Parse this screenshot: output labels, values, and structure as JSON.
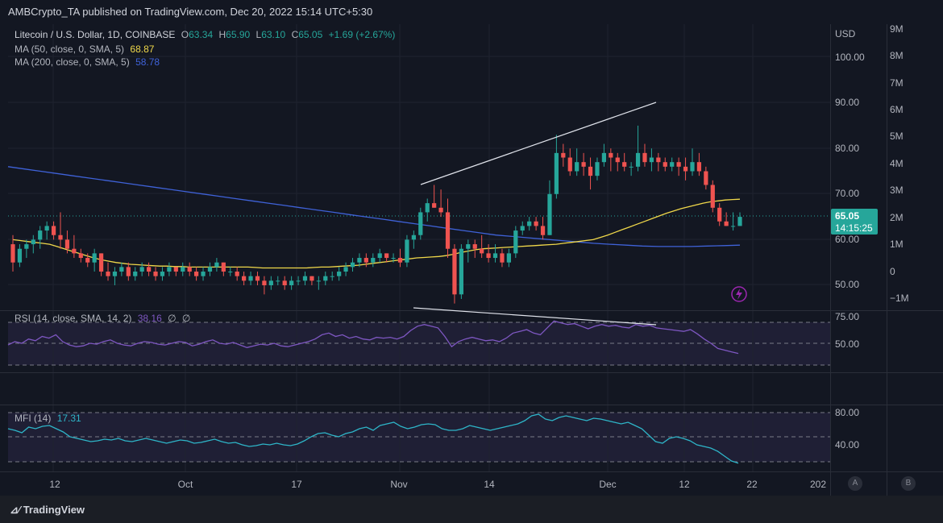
{
  "header": {
    "publisher_line": "AMBCrypto_TA published on TradingView.com, Dec 20, 2022 15:14 UTC+5:30"
  },
  "main_legend": {
    "symbol": "Litecoin / U.S. Dollar, 1D, COINBASE",
    "o_label": "O",
    "o": "63.34",
    "h_label": "H",
    "h": "65.90",
    "l_label": "L",
    "l": "63.10",
    "c_label": "C",
    "c": "65.05",
    "change": "+1.69 (+2.67%)"
  },
  "ma50": {
    "label": "MA (50, close, 0, SMA, 5)",
    "value": "68.87",
    "color": "#f0d84a"
  },
  "ma200": {
    "label": "MA (200, close, 0, SMA, 5)",
    "value": "58.78",
    "color": "#3f62d8"
  },
  "price_axis": {
    "currency": "USD",
    "ticks": [
      "100.00",
      "90.00",
      "80.00",
      "70.00",
      "60.00",
      "50.00"
    ]
  },
  "volume_axis": {
    "ticks": [
      "9M",
      "8M",
      "7M",
      "6M",
      "5M",
      "4M",
      "3M",
      "2M",
      "1M",
      "0",
      "−1M"
    ]
  },
  "price_badge": {
    "price": "65.05",
    "countdown": "14:15:25",
    "color": "#26a69a"
  },
  "rsi": {
    "label": "RSI (14, close, SMA, 14, 2)",
    "value": "38.16",
    "extra1": "∅",
    "extra2": "∅",
    "ticks": [
      "75.00",
      "50.00"
    ],
    "color": "#7e57c2"
  },
  "mfi": {
    "label": "MFI (14)",
    "value": "17.31",
    "ticks": [
      "80.00",
      "40.00"
    ],
    "color": "#2eb5c8"
  },
  "time_axis": {
    "labels": [
      "12",
      "Oct",
      "17",
      "Nov",
      "14",
      "Dec",
      "12",
      "22",
      "202"
    ]
  },
  "scale_buttons": {
    "a": "A",
    "b": "B"
  },
  "footer": {
    "brand": "TradingView"
  },
  "icons": {
    "lightning": "lightning-icon",
    "logo": "tradingview-logo-icon"
  },
  "chart_data": {
    "type": "candlestick",
    "title": "Litecoin / U.S. Dollar, 1D, COINBASE",
    "ylim": [
      45,
      105
    ],
    "candles": [
      [
        59,
        61,
        53,
        55
      ],
      [
        55,
        59,
        54,
        58
      ],
      [
        58,
        60,
        56,
        59
      ],
      [
        59,
        61,
        57,
        60
      ],
      [
        60,
        63,
        58,
        62
      ],
      [
        62,
        64,
        60,
        63
      ],
      [
        63,
        64,
        60,
        61
      ],
      [
        61,
        66,
        58,
        60
      ],
      [
        60,
        62,
        57,
        58
      ],
      [
        58,
        61,
        56,
        57
      ],
      [
        57,
        58,
        55,
        56
      ],
      [
        56,
        57,
        54,
        55
      ],
      [
        55,
        58,
        53,
        57
      ],
      [
        57,
        57,
        52,
        53
      ],
      [
        53,
        55,
        51,
        52
      ],
      [
        52,
        54,
        50,
        53
      ],
      [
        53,
        55,
        52,
        54
      ],
      [
        54,
        55,
        51,
        52
      ],
      [
        52,
        54,
        51,
        53
      ],
      [
        53,
        55,
        52,
        54
      ],
      [
        54,
        55,
        52,
        53
      ],
      [
        53,
        54,
        51,
        52
      ],
      [
        52,
        54,
        51,
        53
      ],
      [
        53,
        55,
        52,
        54
      ],
      [
        54,
        54,
        52,
        53
      ],
      [
        53,
        55,
        52,
        54
      ],
      [
        54,
        55,
        52,
        53
      ],
      [
        53,
        54,
        51,
        52
      ],
      [
        52,
        54,
        51,
        53
      ],
      [
        53,
        55,
        52,
        54
      ],
      [
        54,
        56,
        53,
        55
      ],
      [
        55,
        55,
        52,
        53
      ],
      [
        53,
        54,
        52,
        53
      ],
      [
        53,
        54,
        51,
        52
      ],
      [
        52,
        53,
        50,
        51
      ],
      [
        51,
        53,
        50,
        52
      ],
      [
        52,
        53,
        50,
        51
      ],
      [
        51,
        52,
        48,
        50
      ],
      [
        50,
        52,
        49,
        51
      ],
      [
        51,
        52,
        50,
        51
      ],
      [
        51,
        52,
        49,
        50
      ],
      [
        50,
        52,
        49,
        51
      ],
      [
        51,
        52,
        50,
        51
      ],
      [
        51,
        53,
        50,
        52
      ],
      [
        52,
        52,
        50,
        51
      ],
      [
        51,
        52,
        49,
        51
      ],
      [
        51,
        53,
        50,
        52
      ],
      [
        52,
        53,
        51,
        52
      ],
      [
        52,
        54,
        51,
        53
      ],
      [
        53,
        55,
        52,
        54
      ],
      [
        54,
        56,
        53,
        55
      ],
      [
        55,
        57,
        54,
        56
      ],
      [
        56,
        57,
        54,
        55
      ],
      [
        55,
        57,
        54,
        56
      ],
      [
        56,
        58,
        55,
        57
      ],
      [
        57,
        57,
        55,
        56
      ],
      [
        56,
        57,
        55,
        56
      ],
      [
        56,
        58,
        54,
        55
      ],
      [
        55,
        61,
        54,
        60
      ],
      [
        60,
        62,
        58,
        61
      ],
      [
        61,
        67,
        60,
        66
      ],
      [
        66,
        69,
        64,
        68
      ],
      [
        68,
        72,
        67,
        67
      ],
      [
        67,
        71,
        65,
        66
      ],
      [
        66,
        69,
        56,
        58
      ],
      [
        58,
        59,
        46,
        48
      ],
      [
        48,
        59,
        47,
        58
      ],
      [
        58,
        60,
        55,
        59
      ],
      [
        59,
        60,
        56,
        58
      ],
      [
        58,
        61,
        56,
        57
      ],
      [
        57,
        59,
        55,
        56
      ],
      [
        56,
        59,
        55,
        57
      ],
      [
        57,
        58,
        54,
        55
      ],
      [
        55,
        58,
        54,
        57
      ],
      [
        57,
        63,
        56,
        62
      ],
      [
        62,
        64,
        61,
        63
      ],
      [
        63,
        65,
        62,
        64
      ],
      [
        64,
        65,
        62,
        63
      ],
      [
        63,
        65,
        60,
        61
      ],
      [
        61,
        73,
        61,
        70
      ],
      [
        70,
        83,
        69,
        79
      ],
      [
        79,
        81,
        76,
        78
      ],
      [
        78,
        80,
        74,
        75
      ],
      [
        75,
        80,
        74,
        77
      ],
      [
        77,
        79,
        74,
        76
      ],
      [
        76,
        78,
        71,
        74
      ],
      [
        74,
        78,
        73,
        77
      ],
      [
        77,
        81,
        76,
        79
      ],
      [
        79,
        80,
        75,
        78
      ],
      [
        78,
        79,
        75,
        77
      ],
      [
        77,
        79,
        75,
        76
      ],
      [
        76,
        77,
        74,
        76
      ],
      [
        76,
        85,
        75,
        79
      ],
      [
        79,
        81,
        76,
        77
      ],
      [
        77,
        80,
        75,
        78
      ],
      [
        78,
        79,
        75,
        77
      ],
      [
        77,
        78,
        75,
        76
      ],
      [
        76,
        78,
        75,
        77
      ],
      [
        77,
        78,
        74,
        76
      ],
      [
        76,
        78,
        73,
        75
      ],
      [
        75,
        80,
        74,
        77
      ],
      [
        77,
        79,
        74,
        75
      ],
      [
        75,
        76,
        71,
        72
      ],
      [
        72,
        73,
        66,
        67
      ],
      [
        67,
        68,
        63,
        64
      ],
      [
        64,
        66,
        63,
        63
      ],
      [
        63,
        66,
        62,
        63
      ],
      [
        63,
        66,
        63,
        65
      ]
    ],
    "ma50": [
      60,
      59.8,
      59.6,
      59.4,
      59.2,
      59,
      58.5,
      58,
      57.5,
      57,
      56.5,
      56,
      55.6,
      55.3,
      55,
      54.8,
      54.6,
      54.5,
      54.4,
      54.3,
      54.2,
      54.2,
      54.1,
      54.1,
      54,
      54,
      54,
      54,
      54,
      54,
      54,
      54,
      54,
      53.9,
      53.8,
      53.8,
      53.8,
      53.8,
      53.8,
      53.8,
      53.8,
      53.9,
      54,
      54,
      54.1,
      54.2,
      54.3,
      54.4,
      54.6,
      54.8,
      55,
      55.2,
      55.4,
      55.6,
      55.8,
      56,
      56.1,
      56.2,
      56.3,
      56.5,
      56.8,
      57.2,
      57.5,
      57.8,
      58,
      58.1,
      58.2,
      58.3,
      58.4,
      58.5,
      58.6,
      58.7,
      58.8,
      58.9,
      59,
      59.2,
      59.4,
      59.6,
      59.8,
      60,
      60.5,
      61,
      61.6,
      62.2,
      62.8,
      63.4,
      64,
      64.6,
      65.2,
      65.8,
      66.3,
      66.8,
      67.2,
      67.6,
      68,
      68.3,
      68.5,
      68.7,
      68.8,
      68.87
    ],
    "ma200": [
      76,
      75.5,
      75,
      74.5,
      74,
      73.5,
      73,
      72.5,
      72,
      71.5,
      71,
      70.5,
      70,
      69.5,
      69,
      68.5,
      68,
      67.5,
      67,
      66.5,
      66,
      65.5,
      65,
      64.5,
      64,
      63.5,
      63,
      62.5,
      62,
      61.5,
      61,
      60.7,
      60.4,
      60.1,
      59.8,
      59.5,
      59.2,
      59,
      58.8,
      58.6,
      58.5,
      58.5,
      58.5,
      58.6,
      58.7,
      58.8
    ],
    "rsi": [
      48,
      52,
      50,
      55,
      53,
      58,
      56,
      60,
      52,
      48,
      46,
      47,
      50,
      49,
      52,
      54,
      50,
      48,
      47,
      50,
      52,
      51,
      49,
      48,
      50,
      52,
      51,
      47,
      49,
      52,
      54,
      50,
      49,
      51,
      48,
      45,
      47,
      49,
      48,
      50,
      47,
      46,
      48,
      50,
      52,
      55,
      60,
      62,
      58,
      60,
      56,
      58,
      55,
      54,
      57,
      56,
      57,
      55,
      58,
      65,
      70,
      72,
      70,
      68,
      58,
      46,
      52,
      55,
      57,
      55,
      53,
      54,
      52,
      56,
      62,
      64,
      66,
      62,
      60,
      68,
      76,
      74,
      72,
      73,
      70,
      67,
      70,
      72,
      70,
      71,
      69,
      68,
      72,
      70,
      71,
      68,
      67,
      66,
      65,
      64,
      66,
      61,
      55,
      50,
      44,
      42,
      40,
      38.16
    ],
    "mfi": [
      60,
      58,
      55,
      62,
      60,
      63,
      64,
      60,
      56,
      50,
      48,
      46,
      44,
      45,
      47,
      46,
      48,
      45,
      44,
      46,
      48,
      46,
      44,
      42,
      44,
      46,
      45,
      42,
      43,
      45,
      47,
      44,
      42,
      43,
      40,
      38,
      39,
      41,
      40,
      42,
      40,
      39,
      41,
      45,
      50,
      54,
      55,
      52,
      50,
      54,
      56,
      60,
      62,
      58,
      64,
      66,
      68,
      63,
      60,
      62,
      65,
      66,
      65,
      60,
      58,
      58,
      60,
      64,
      62,
      60,
      58,
      60,
      62,
      64,
      66,
      70,
      76,
      78,
      72,
      70,
      74,
      76,
      74,
      72,
      70,
      73,
      72,
      70,
      68,
      66,
      68,
      64,
      60,
      52,
      44,
      42,
      48,
      50,
      48,
      45,
      40,
      38,
      36,
      32,
      26,
      20,
      17.31
    ]
  }
}
